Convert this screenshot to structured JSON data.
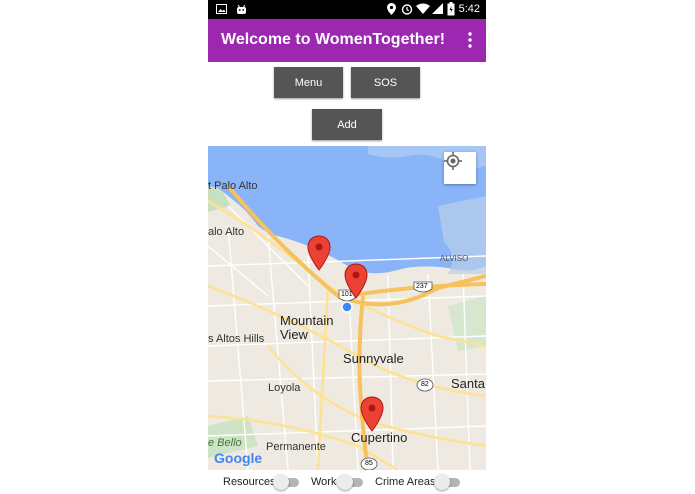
{
  "status_bar": {
    "icons": [
      "image-icon",
      "android-icon",
      "location-icon",
      "alarm-icon",
      "wifi-icon",
      "signal-icon",
      "battery-icon"
    ],
    "time": "5:42"
  },
  "app_bar": {
    "title": "Welcome to WomenTogether!",
    "color": "#9c27b0",
    "overflow_icon": "more-vert-icon"
  },
  "buttons": {
    "menu": "Menu",
    "sos": "SOS",
    "add": "Add",
    "color": "#555555"
  },
  "map": {
    "labels": {
      "east_palo_alto": "t Palo Alto",
      "palo_alto": "alo Alto",
      "alviso": "ALVISO",
      "mountain_view": "Mountain\nView",
      "sunnyvale": "Sunnyvale",
      "los_altos_hills": "s Altos Hills",
      "loyola": "Loyola",
      "santa": "Santa",
      "bello": "e Bello",
      "permanente": "Permanente",
      "cupertino": "Cupertino",
      "highway_101": "101",
      "highway_237": "237",
      "highway_82": "82",
      "highway_85": "85",
      "google_logo": "Google"
    },
    "markers": 3,
    "water_color": "#8ab4f8",
    "marker_color": "#ea4335"
  },
  "toggles": [
    {
      "label": "Resources",
      "on": false
    },
    {
      "label": "Work",
      "on": false
    },
    {
      "label": "Crime Areas",
      "on": false
    }
  ]
}
